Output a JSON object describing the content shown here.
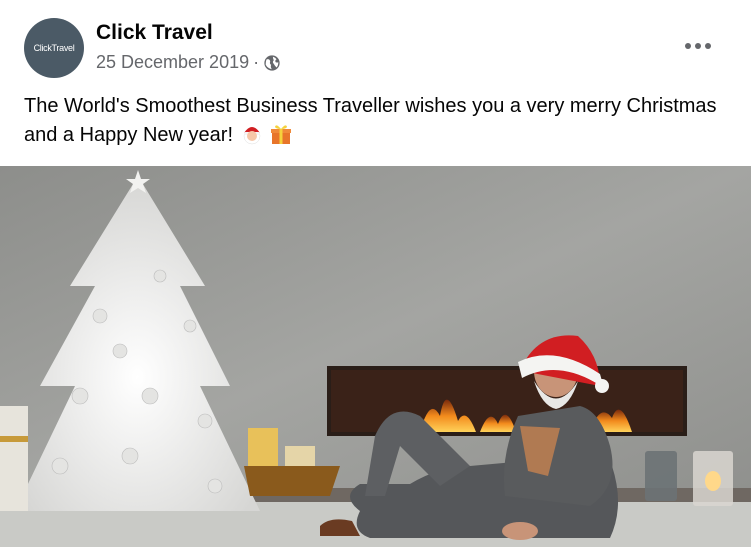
{
  "post": {
    "page_name": "Click Travel",
    "avatar_text": "ClickTravel",
    "date": "25 December 2019",
    "separator": "·",
    "privacy_icon": "globe-icon",
    "more_icon": "more-options-icon",
    "caption_text": "The World's Smoothest Business Traveller wishes you a very merry Christmas and a Happy New year!",
    "caption_emojis": [
      "santa-emoji",
      "gift-emoji"
    ],
    "image_description_icon": "photo"
  },
  "colors": {
    "wall": "#9a9b98",
    "carpet": "#c9cac6",
    "fire": "#f28a1c",
    "hat": "#d11e22",
    "suit": "#5b5c5c",
    "text_primary": "#050505",
    "text_secondary": "#65676b"
  }
}
